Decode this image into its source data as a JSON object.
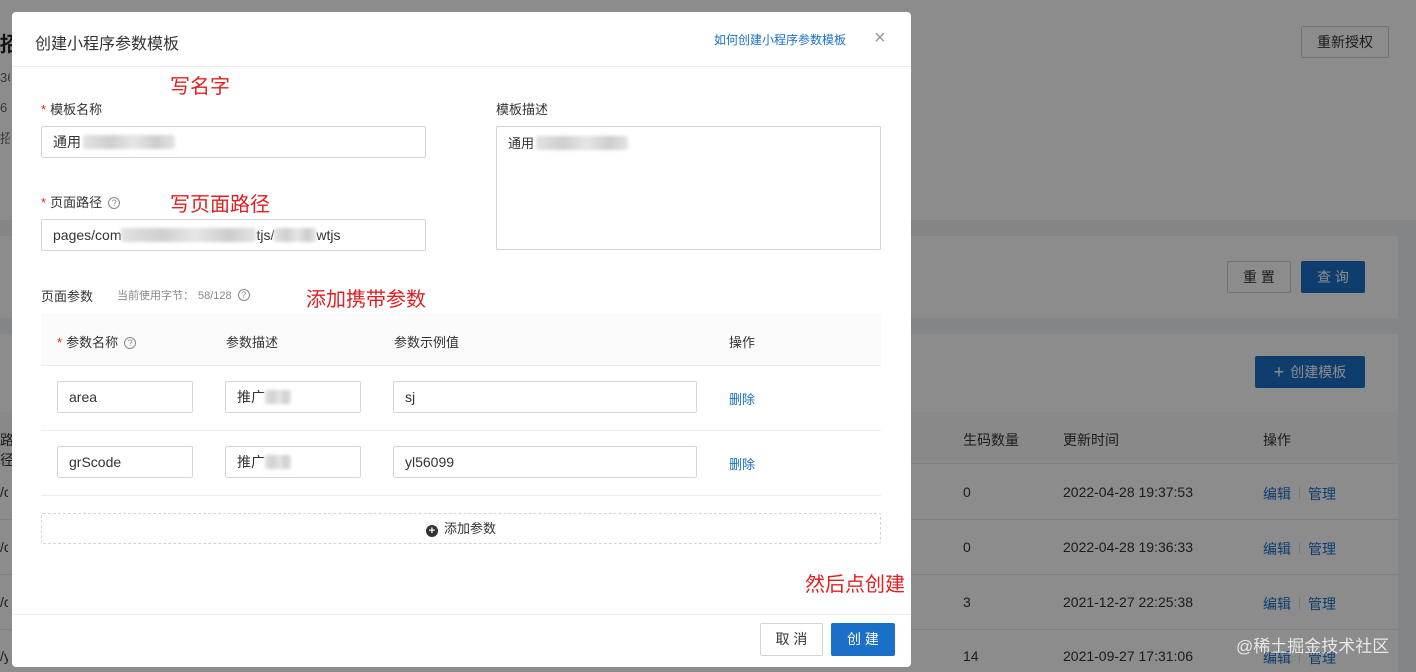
{
  "background": {
    "title_fragment": "招",
    "frag_1": "36",
    "frag_2": "6",
    "frag_3": "招",
    "reauthorize_label": "重新授权",
    "reset_label": "重 置",
    "query_label": "查 询",
    "create_template_label": "创建模板",
    "table": {
      "col_path_fragment": "路径",
      "col_code_count": "生码数量",
      "col_updated": "更新时间",
      "col_actions": "操作",
      "edit_label": "编辑",
      "manage_label": "管理",
      "rows": [
        {
          "frag": "/c",
          "count": "0",
          "updated": "2022-04-28 19:37:53"
        },
        {
          "frag": "/c",
          "count": "0",
          "updated": "2022-04-28 19:36:33"
        },
        {
          "frag": "/c",
          "count": "3",
          "updated": "2021-12-27 22:25:38"
        },
        {
          "frag": "/y",
          "count": "14",
          "updated": "2021-09-27 17:31:06"
        }
      ]
    }
  },
  "modal": {
    "title": "创建小程序参数模板",
    "help_link": "如何创建小程序参数模板",
    "close_glyph": "×",
    "required_mark": "*",
    "help_glyph": "?",
    "template_name": {
      "label": "模板名称",
      "value": "通用"
    },
    "template_desc": {
      "label": "模板描述",
      "value": "通用"
    },
    "page_path": {
      "label": "页面路径",
      "value_a": "pages/com",
      "value_b": "tjs/",
      "value_c": "wtjs"
    },
    "page_params": {
      "label": "页面参数",
      "usage_label": "当前使用字节：",
      "usage_value": "58/128",
      "headers": {
        "name": "参数名称",
        "desc": "参数描述",
        "example": "参数示例值",
        "action": "操作"
      },
      "rows": [
        {
          "name": "area",
          "desc": "推广",
          "example": "sj",
          "delete": "删除"
        },
        {
          "name": "grScode",
          "desc": "推广",
          "example": "yl56099",
          "delete": "删除"
        }
      ],
      "add_label": "添加参数",
      "add_glyph": "+"
    },
    "cancel_label": "取 消",
    "create_label": "创 建"
  },
  "annotations": {
    "write_name": "写名字",
    "write_path": "写页面路径",
    "add_params": "添加携带参数",
    "then_create": "然后点创建"
  },
  "watermark": "@稀土掘金技术社区",
  "colors": {
    "primary": "#1a6fc9",
    "annotation": "#e02020",
    "required": "#e02020"
  }
}
